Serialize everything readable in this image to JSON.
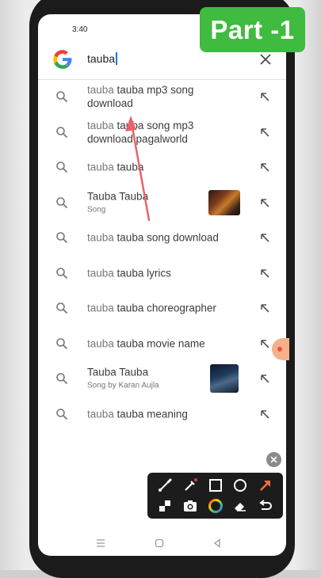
{
  "status_bar": {
    "time": "3:40"
  },
  "badge": {
    "label": "Part -1"
  },
  "search": {
    "query": "tauba"
  },
  "suggestions": [
    {
      "lead": "tauba",
      "rest": " tauba mp3 song download",
      "subtitle": null,
      "thumbnail": false
    },
    {
      "lead": "tauba",
      "rest": " tauba song mp3 download pagalworld",
      "subtitle": null,
      "thumbnail": false
    },
    {
      "lead": "tauba",
      "rest": " tauba",
      "subtitle": null,
      "thumbnail": false
    },
    {
      "lead": "",
      "rest": "Tauba Tauba",
      "subtitle": "Song",
      "thumbnail": true
    },
    {
      "lead": "tauba",
      "rest": " tauba song download",
      "subtitle": null,
      "thumbnail": false
    },
    {
      "lead": "tauba",
      "rest": " tauba lyrics",
      "subtitle": null,
      "thumbnail": false
    },
    {
      "lead": "tauba",
      "rest": " tauba choreographer",
      "subtitle": null,
      "thumbnail": false
    },
    {
      "lead": "tauba",
      "rest": " tauba movie name",
      "subtitle": null,
      "thumbnail": false
    },
    {
      "lead": "",
      "rest": "Tauba Tauba",
      "subtitle": "Song by Karan Aujla",
      "thumbnail": true
    },
    {
      "lead": "tauba",
      "rest": " tauba meaning",
      "subtitle": null,
      "thumbnail": false
    }
  ],
  "icons": {
    "logo": "google-icon",
    "clear": "close-icon",
    "suggestion": "search-icon",
    "fill": "arrow-up-left-icon",
    "annotation_tools": [
      "brush-icon",
      "laser-pen-icon",
      "rectangle-icon",
      "circle-icon",
      "arrow-icon",
      "mosaic-icon",
      "camera-icon",
      "color-wheel-icon",
      "eraser-icon",
      "undo-icon"
    ],
    "nav": [
      "menu-icon",
      "home-icon",
      "back-icon"
    ]
  },
  "colors": {
    "badge": "#3fbb3f",
    "annotation_arrow": "#e8636b",
    "toolbar": "#1c1c1c",
    "accent": "#1a73e8"
  }
}
